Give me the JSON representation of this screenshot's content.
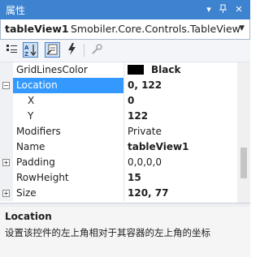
{
  "window": {
    "title": "属性"
  },
  "object_selector": {
    "name": "tableView1",
    "type": "Smobiler.Core.Controls.TableView"
  },
  "toolbar": {
    "buttons": [
      "categorized-icon",
      "alphabetical-icon",
      "properties-icon",
      "events-icon",
      "property-pages-icon"
    ]
  },
  "properties": [
    {
      "name": "GridLinesColor",
      "value": "Black",
      "color_swatch": "#000000"
    },
    {
      "name": "Location",
      "value": "0, 122",
      "expander": "−",
      "selected": true
    },
    {
      "name": "X",
      "value": "0"
    },
    {
      "name": "Y",
      "value": "122"
    },
    {
      "name": "Modifiers",
      "value": "Private"
    },
    {
      "name": "Name",
      "value": "tableView1"
    },
    {
      "name": "Padding",
      "value": "0,0,0,0",
      "expander": "+"
    },
    {
      "name": "RowHeight",
      "value": "15"
    },
    {
      "name": "Size",
      "value": "120, 77",
      "expander": "+"
    }
  ],
  "description": {
    "title": "Location",
    "text": "设置该控件的左上角相对于其容器的左上角的坐标"
  },
  "colors": {
    "title_bar": "#3e83cf",
    "selection": "#3399ff"
  }
}
